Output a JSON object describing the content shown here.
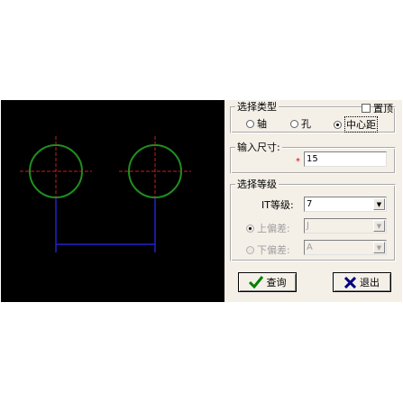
{
  "type_group": {
    "title": "选择类型",
    "pin_label": "置顶",
    "options": [
      "轴",
      "孔",
      "中心距"
    ],
    "selected": 2
  },
  "size_group": {
    "title": "输入尺寸:",
    "required_mark": "*",
    "value": "15"
  },
  "grade_group": {
    "title": "选择等级",
    "it_label": "IT等级:",
    "it_value": "7",
    "upper_label": "上偏差:",
    "upper_value": "J",
    "lower_label": "下偏差:",
    "lower_value": "A"
  },
  "buttons": {
    "query_label": "查询",
    "exit_label": "退出"
  },
  "colors": {
    "canvas_bg": "#000000",
    "circle": "#1f8f1f",
    "centerline": "#c02020",
    "dimension": "#2020d0",
    "check": "#008000",
    "cross": "#000080"
  }
}
